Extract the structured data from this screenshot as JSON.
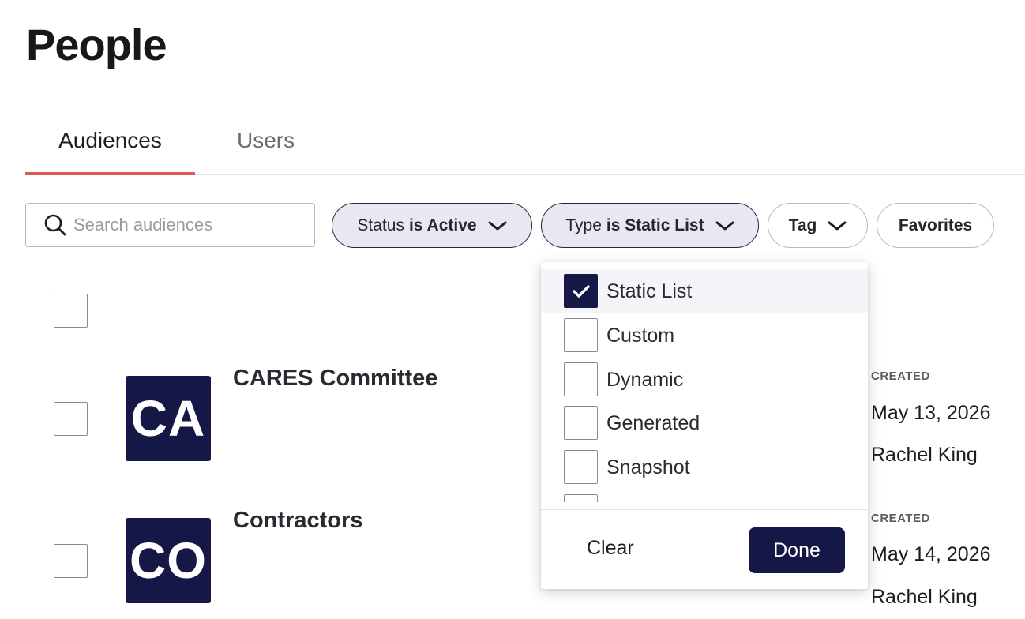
{
  "page": {
    "title": "People"
  },
  "tabs": [
    {
      "label": "Audiences",
      "active": true
    },
    {
      "label": "Users",
      "active": false
    }
  ],
  "search": {
    "placeholder": "Search audiences",
    "value": "",
    "icon": "search-icon"
  },
  "filters": {
    "status": {
      "prefix": "Status",
      "value": "is Active"
    },
    "type": {
      "prefix": "Type",
      "value": "is Static List"
    },
    "tag": {
      "label": "Tag"
    },
    "favorites": {
      "label": "Favorites"
    }
  },
  "type_dropdown": {
    "options": [
      {
        "label": "Static List",
        "checked": true
      },
      {
        "label": "Custom",
        "checked": false
      },
      {
        "label": "Dynamic",
        "checked": false
      },
      {
        "label": "Generated",
        "checked": false
      },
      {
        "label": "Snapshot",
        "checked": false
      }
    ],
    "clear_label": "Clear",
    "done_label": "Done"
  },
  "audiences": [
    {
      "initials": "CA",
      "name": "CARES Committee",
      "created_label": "CREATED",
      "created_date": "May 13, 2026",
      "created_by": "Rachel King"
    },
    {
      "initials": "CO",
      "name": "Contractors",
      "created_label": "CREATED",
      "created_date": "May 14, 2026",
      "created_by": "Rachel King"
    }
  ],
  "colors": {
    "accent": "#151747",
    "tab_underline": "#d95a5a",
    "chip_fill": "#e9e8f2"
  }
}
